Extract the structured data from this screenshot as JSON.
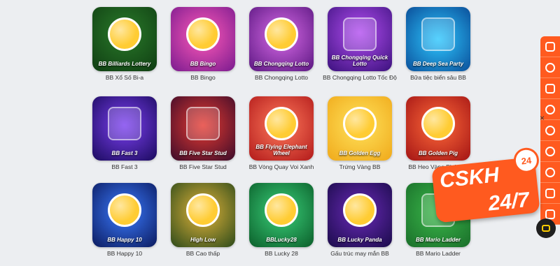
{
  "games": [
    {
      "title": "BB Xổ Số Bi-a",
      "brand": "BB Billiards Lottery"
    },
    {
      "title": "BB Bingo",
      "brand": "BB Bingo"
    },
    {
      "title": "BB Chongqing Lotto",
      "brand": "BB Chongqing Lotto"
    },
    {
      "title": "BB Chongqing Lotto Tốc Độ",
      "brand": "BB Chongqing Quick Lotto"
    },
    {
      "title": "Bữa tiệc biển sâu BB",
      "brand": "BB Deep Sea Party"
    },
    {
      "title": "BB Fast 3",
      "brand": "BB Fast 3"
    },
    {
      "title": "BB Five Star Stud",
      "brand": "BB Five Star Stud"
    },
    {
      "title": "BB Vòng Quay Voi Xanh",
      "brand": "BB Flying Elephant Wheel"
    },
    {
      "title": "Trứng Vàng BB",
      "brand": "BB Golden Egg"
    },
    {
      "title": "BB Heo Vàng Phát Tài",
      "brand": "BB Golden Pig"
    },
    {
      "title": "BB Happy 10",
      "brand": "BB Happy 10"
    },
    {
      "title": "BB Cao thấp",
      "brand": "High Low"
    },
    {
      "title": "BB Lucky 28",
      "brand": "BBLucky28"
    },
    {
      "title": "Gấu trúc may mắn BB",
      "brand": "BB Lucky Panda"
    },
    {
      "title": "BB Mario Ladder",
      "brand": "BB Mario Ladder"
    }
  ],
  "support": {
    "line1": "CSKH",
    "line2": "24/7",
    "badge": "24"
  },
  "close_glyph": "×"
}
